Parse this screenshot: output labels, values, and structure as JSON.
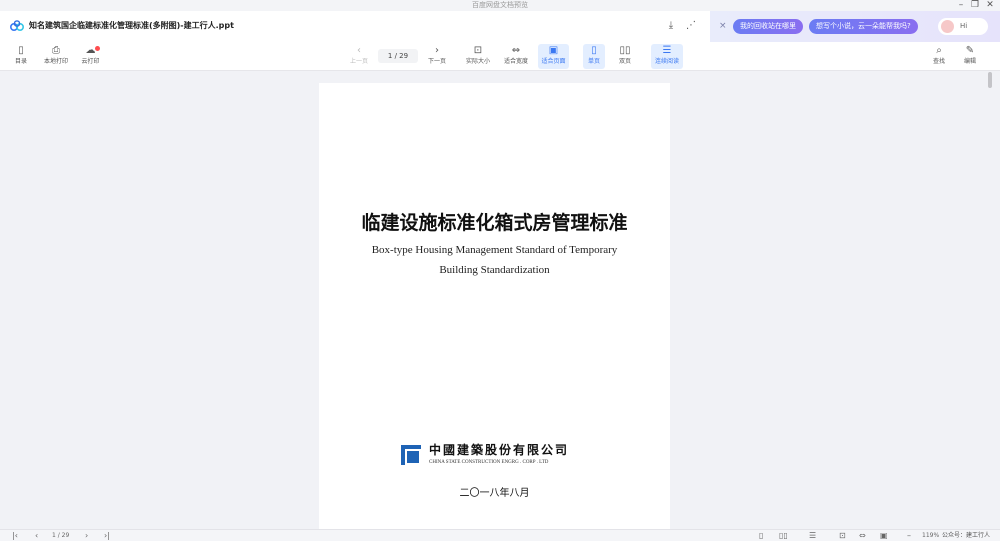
{
  "window": {
    "title": "百度网盘文档预览",
    "min_icon": "–",
    "restore_icon": "❐",
    "close_icon": "✕"
  },
  "header": {
    "filename": "知名建筑国企临建标准化管理标准(多附图)-建工行人.ppt",
    "download_icon": "⤓",
    "share_icon": "⋰"
  },
  "ai_panel": {
    "close_label": "×",
    "chip1": "我的回收站在哪里",
    "chip2": "想写个小说，云一朵能帮我吗?",
    "hi_label": "Hi"
  },
  "toolbar": {
    "toc": {
      "icon": "▯",
      "label": "目录"
    },
    "local_print": {
      "icon": "⎙",
      "label": "本地打印"
    },
    "cloud_print": {
      "icon": "☁",
      "label": "云打印"
    },
    "prev": {
      "icon": "‹",
      "label": "上一页"
    },
    "page_indicator": "1 / 29",
    "next": {
      "icon": "›",
      "label": "下一页"
    },
    "actual_size": {
      "icon": "⊡",
      "label": "实际大小"
    },
    "fit_width": {
      "icon": "⇔",
      "label": "适合宽度"
    },
    "fit_page": {
      "icon": "▣",
      "label": "适合页面"
    },
    "single_page": {
      "icon": "▯",
      "label": "单页"
    },
    "double_page": {
      "icon": "▯▯",
      "label": "双页"
    },
    "continuous": {
      "icon": "☰",
      "label": "连续阅读"
    },
    "find": {
      "icon": "⌕",
      "label": "查找"
    },
    "edit": {
      "icon": "✎",
      "label": "编辑"
    }
  },
  "document": {
    "title_cn": "临建设施标准化箱式房管理标准",
    "title_en_line1": "Box-type Housing Management Standard of Temporary",
    "title_en_line2": "Building Standardization",
    "company_cn": "中國建築股份有限公司",
    "company_en": "CHINA STATE CONSTRUCTION ENGRG . CORP . LTD",
    "date": "二〇一八年八月"
  },
  "statusbar": {
    "first": "|‹",
    "prev": "‹",
    "page": "1 / 29",
    "next": "›",
    "last": "›|",
    "view_single": "▯",
    "view_double": "▯▯",
    "view_scroll": "☰",
    "fit_actual": "⊡",
    "fit_width": "⇔",
    "fit_page": "▣",
    "zoom_out": "–",
    "zoom_value": "119%",
    "watermark": "公众号：建工行人"
  },
  "colors": {
    "accent": "#3a78f2",
    "ai_gradient_start": "#6b7cf3",
    "ai_gradient_end": "#8a6ef0",
    "company_blue": "#1e63b5"
  }
}
